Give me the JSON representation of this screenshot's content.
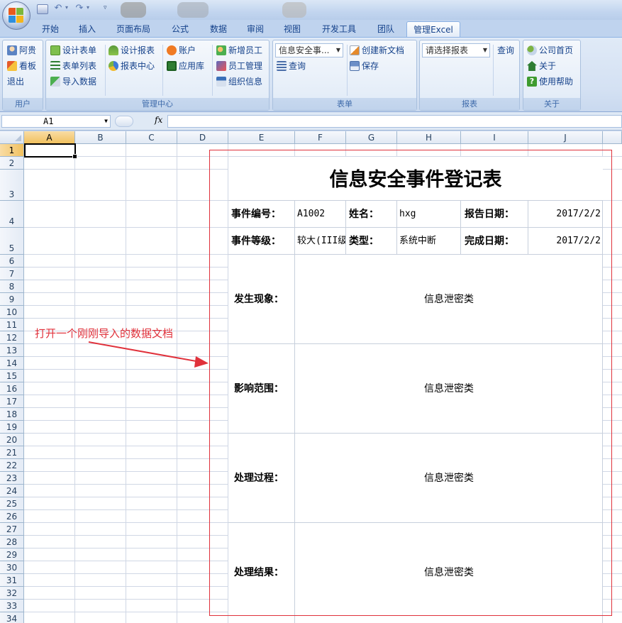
{
  "qat": {
    "customize_icon": "customize-qat-icon"
  },
  "tabs": [
    {
      "label": "开始"
    },
    {
      "label": "插入"
    },
    {
      "label": "页面布局"
    },
    {
      "label": "公式"
    },
    {
      "label": "数据"
    },
    {
      "label": "审阅"
    },
    {
      "label": "视图"
    },
    {
      "label": "开发工具"
    },
    {
      "label": "团队"
    },
    {
      "label": "管理Excel"
    }
  ],
  "ribbon": {
    "user": {
      "label": "用户",
      "items": [
        "阿贵",
        "看板",
        "退出"
      ]
    },
    "manage": {
      "label": "管理中心",
      "col1": [
        "设计表单",
        "表单列表",
        "导入数据"
      ],
      "col2": [
        "设计报表",
        "报表中心"
      ],
      "col3": [
        "账户",
        "应用库"
      ],
      "col4": [
        "新增员工",
        "员工管理",
        "组织信息"
      ]
    },
    "form": {
      "label": "表单",
      "combo_value": "信息安全事...",
      "query": "查询",
      "create": "创建新文档",
      "save": "保存"
    },
    "report": {
      "label": "报表",
      "combo_value": "请选择报表",
      "query": "查询"
    },
    "about": {
      "label": "关于",
      "items": [
        "公司首页",
        "关于",
        "使用帮助"
      ]
    }
  },
  "formula_bar": {
    "cell_ref": "A1",
    "fx": "fx",
    "formula": ""
  },
  "columns": [
    "A",
    "B",
    "C",
    "D",
    "E",
    "F",
    "G",
    "H",
    "I",
    "J"
  ],
  "rows": [
    "1",
    "2",
    "3",
    "4",
    "5",
    "6",
    "7",
    "8",
    "9",
    "10",
    "11",
    "12",
    "13",
    "14",
    "15",
    "16",
    "17",
    "18",
    "19",
    "20",
    "21",
    "22",
    "23",
    "24",
    "25",
    "26",
    "27",
    "28",
    "29",
    "30",
    "31",
    "32",
    "33",
    "34"
  ],
  "document": {
    "title": "信息安全事件登记表",
    "event_no_label": "事件编号：",
    "event_no": "A1002",
    "name_label": "姓名：",
    "name": "hxg",
    "report_date_label": "报告日期：",
    "report_date": "2017/2/2",
    "level_label": "事件等级：",
    "level": "较大(III级",
    "type_label": "类型：",
    "type": "系统中断",
    "finish_date_label": "完成日期：",
    "finish_date": "2017/2/2",
    "phenomenon_label": "发生现象：",
    "phenomenon": "信息泄密类",
    "scope_label": "影响范围：",
    "scope": "信息泄密类",
    "process_label": "处理过程：",
    "process": "信息泄密类",
    "result_label": "处理结果：",
    "result": "信息泄密类"
  },
  "annotation": "打开一个刚刚导入的数据文档",
  "colors": {
    "annotation": "#e0313b",
    "ribbon_text": "#15428b",
    "selection": "#f1c15f"
  }
}
